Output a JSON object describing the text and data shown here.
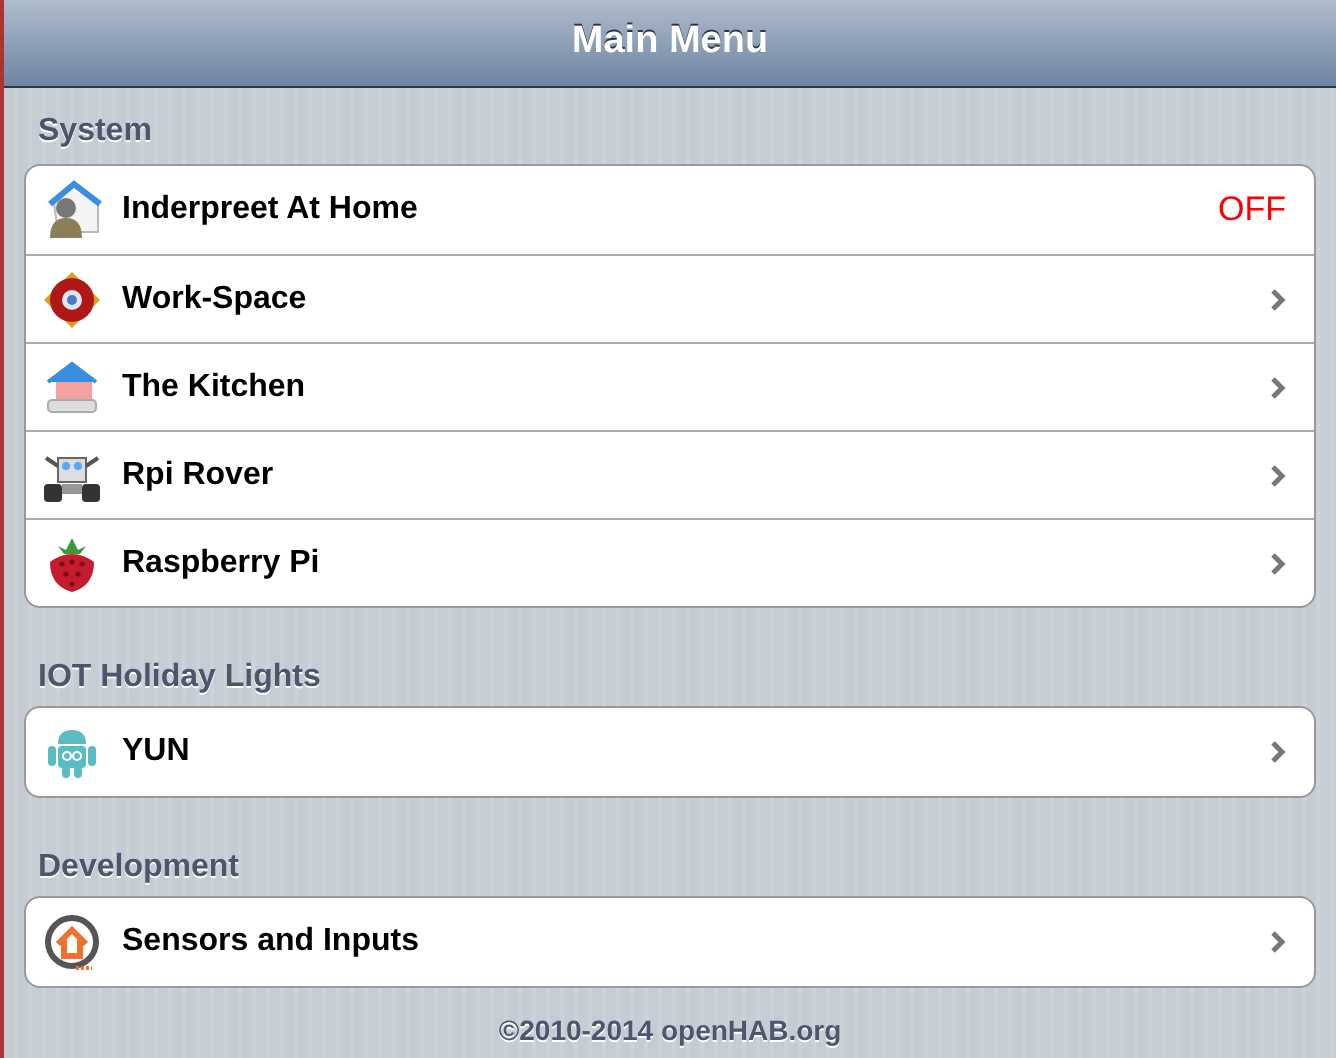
{
  "header": {
    "title": "Main Menu"
  },
  "sections": [
    {
      "title": "System",
      "items": [
        {
          "kind": "switch",
          "label": "Inderpreet At Home",
          "value": "OFF"
        },
        {
          "kind": "link",
          "label": "Work-Space"
        },
        {
          "kind": "link",
          "label": "The Kitchen"
        },
        {
          "kind": "link",
          "label": "Rpi Rover"
        },
        {
          "kind": "link",
          "label": "Raspberry Pi"
        }
      ]
    },
    {
      "title": "IOT Holiday Lights",
      "items": [
        {
          "kind": "link",
          "label": "YUN"
        }
      ]
    },
    {
      "title": "Development",
      "items": [
        {
          "kind": "link",
          "label": "Sensors and Inputs"
        }
      ]
    }
  ],
  "footer": "©2010-2014 openHAB.org"
}
